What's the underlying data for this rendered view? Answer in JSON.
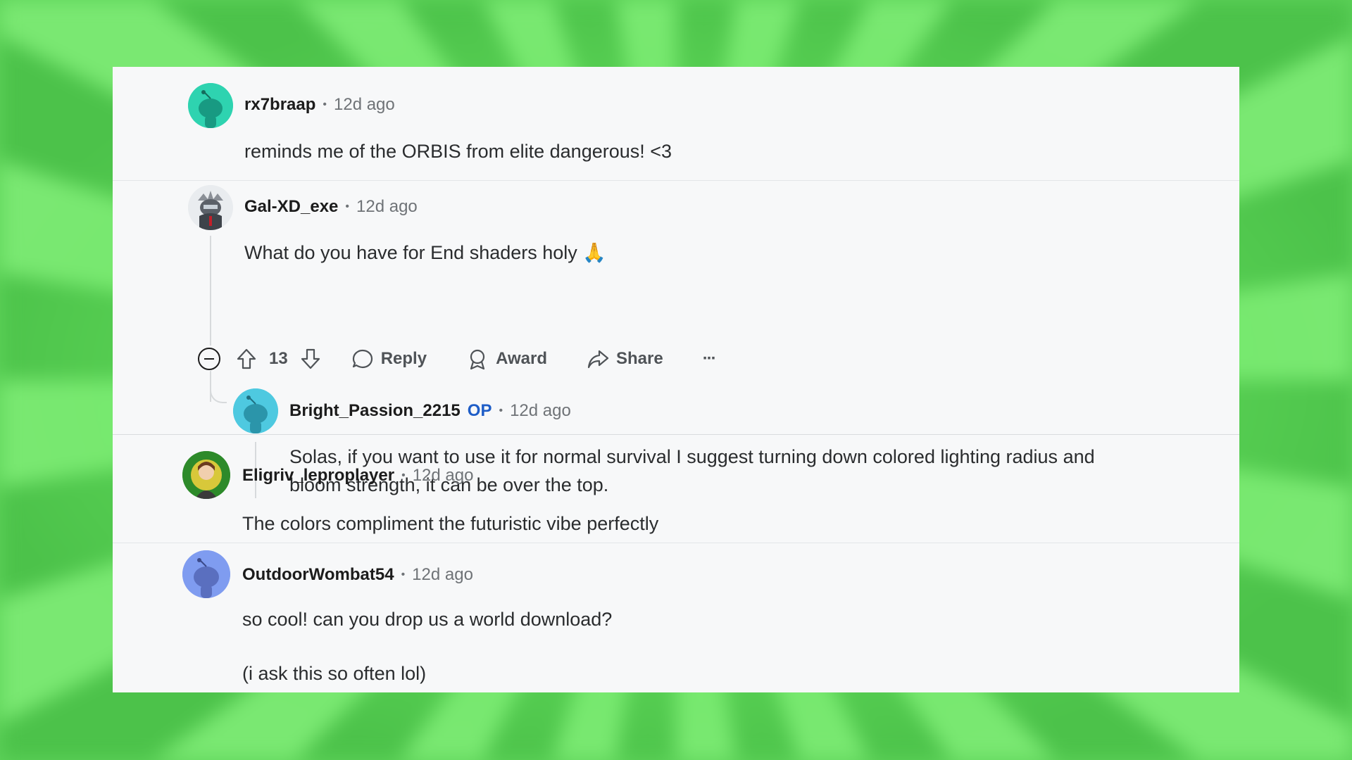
{
  "comments": [
    {
      "username": "rx7braap",
      "time": "12d ago",
      "text": "reminds me of the ORBIS from elite dangerous! <3",
      "avatar_color": "#2ed3b0"
    },
    {
      "username": "Gal-XD_exe",
      "time": "12d ago",
      "text": "What do you have for End shaders holy 🙏",
      "actions": {
        "score": "13",
        "reply": "Reply",
        "award": "Award",
        "share": "Share",
        "more": "···"
      }
    },
    {
      "username": "Bright_Passion_2215",
      "op_badge": "OP",
      "time": "12d ago",
      "text_line1": "Solas, if you want to use it for normal survival I suggest turning down colored lighting radius and",
      "text_line2": "bloom strength, it can be over the top.",
      "avatar_color": "#4ec9e0"
    },
    {
      "username": "Eligriv_leproplayer",
      "time": "12d ago",
      "text": "The colors compliment the futuristic vibe perfectly"
    },
    {
      "username": "OutdoorWombat54",
      "time": "12d ago",
      "text_line1": "so cool! can you drop us a world download?",
      "text_line2": "(i ask this so often lol)",
      "avatar_color": "#7f9cf0"
    }
  ],
  "colors": {
    "background_green": "#5ed35a",
    "card": "#f7f8f9",
    "op_blue": "#1e5dc7"
  }
}
